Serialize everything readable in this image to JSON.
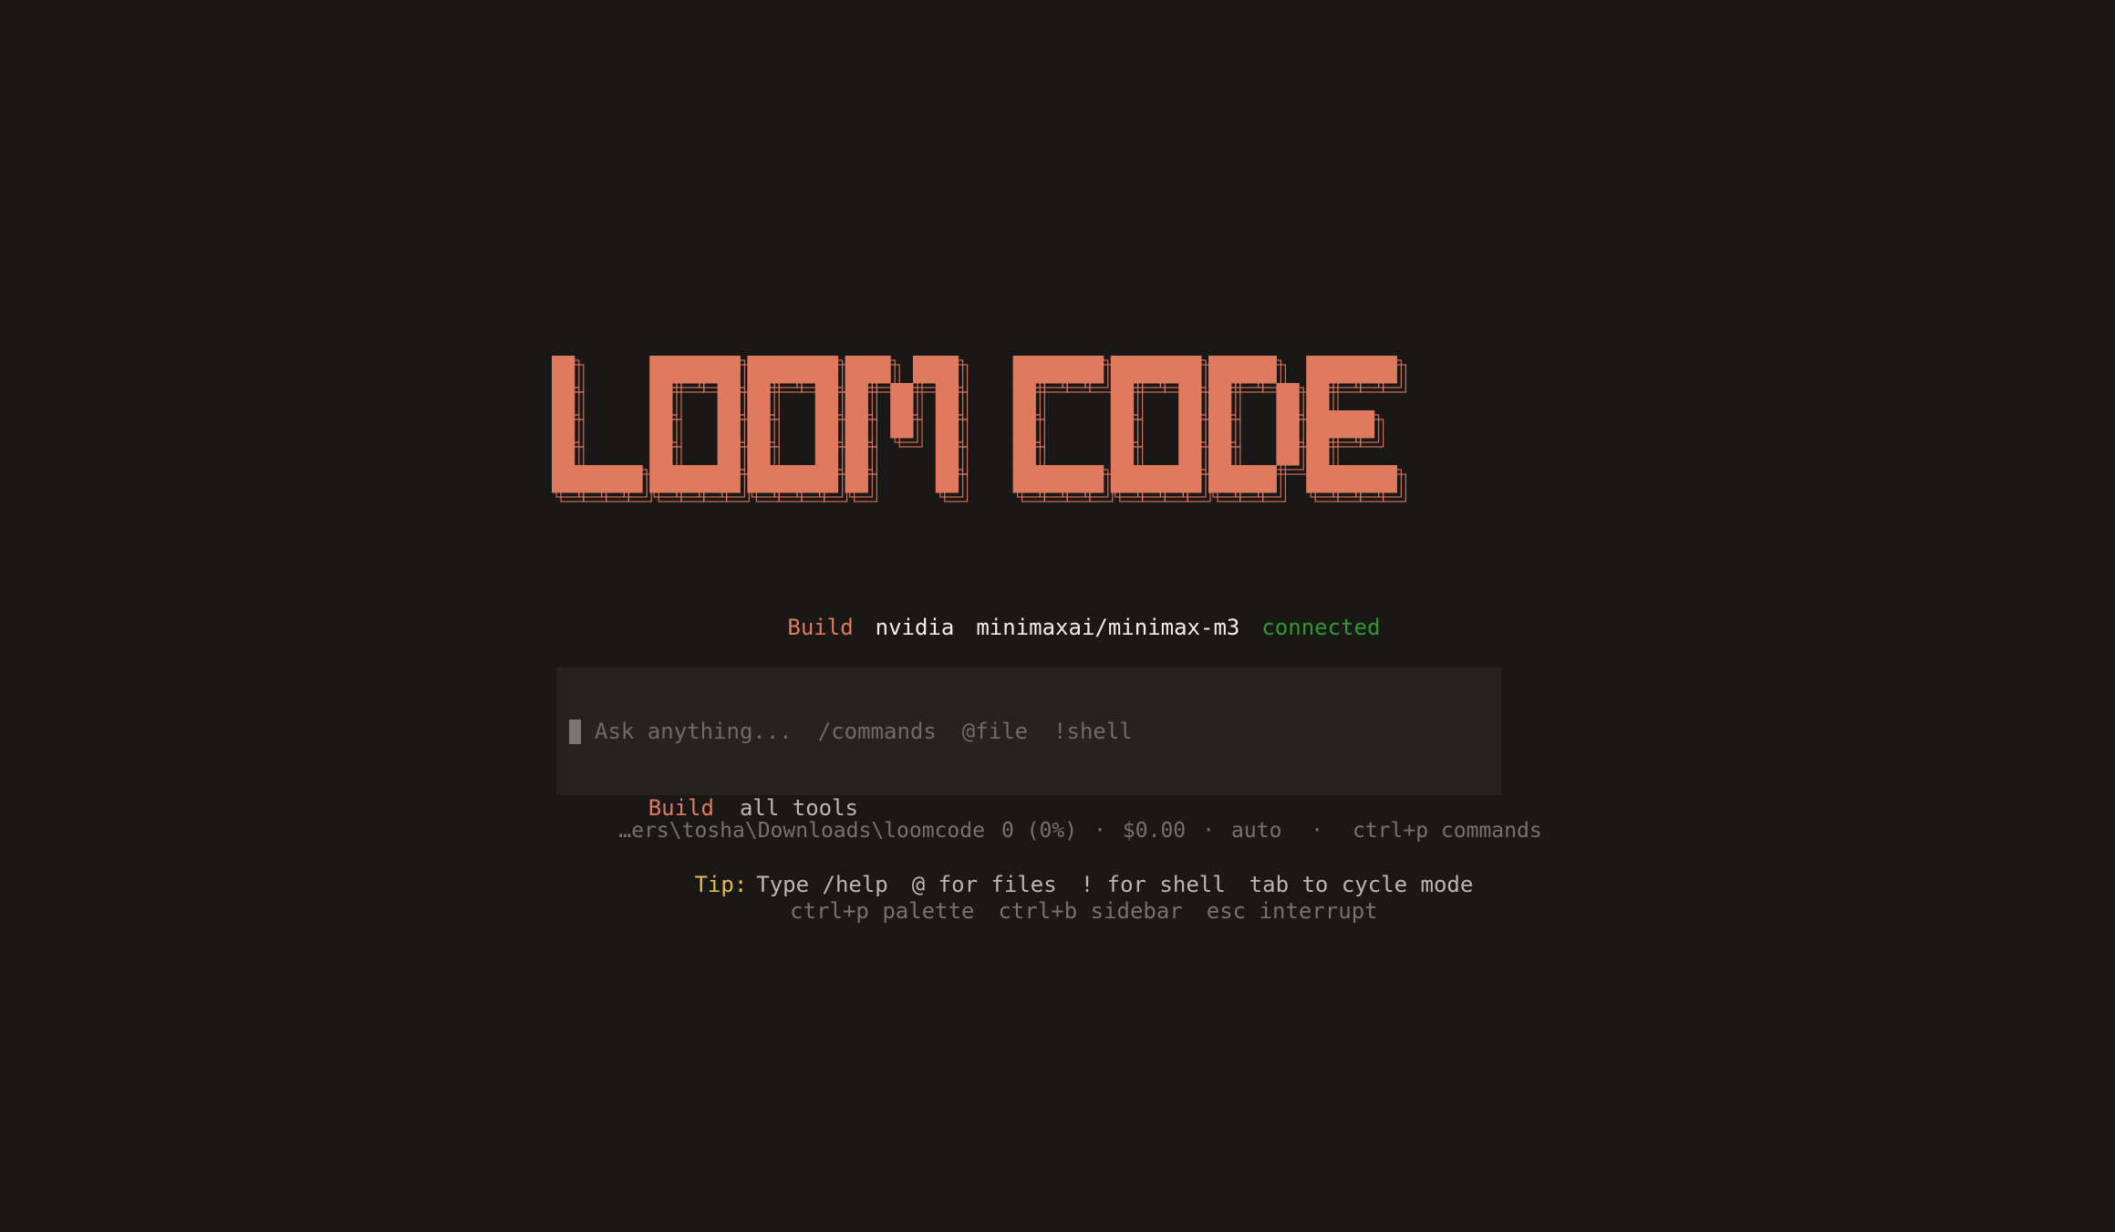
{
  "logo": {
    "text": "LOOM CODE",
    "color": "#e07a5f"
  },
  "status": {
    "mode": "Build",
    "provider": "nvidia",
    "model": "minimaxai/minimax-m3",
    "connection": "connected"
  },
  "prompt": {
    "placeholder": "Ask anything...",
    "hints": [
      "/commands",
      "@file",
      "!shell"
    ],
    "mode": "Build",
    "tools": "all tools"
  },
  "footer": {
    "path": "…ers\\tosha\\Downloads\\loomcode",
    "tokens": "0 (0%)",
    "cost": "$0.00",
    "model_mode": "auto",
    "palette_hint": "ctrl+p commands"
  },
  "tip": {
    "label": "Tip:",
    "items": [
      "Type /help",
      "@ for files",
      "! for shell",
      "tab to cycle mode"
    ]
  },
  "keys": [
    "ctrl+p palette",
    "ctrl+b sidebar",
    "esc interrupt"
  ],
  "colors": {
    "background": "#1a1816",
    "accent": "#e07a5f",
    "connected": "#2e9a2e",
    "tip": "#e5b94c"
  }
}
